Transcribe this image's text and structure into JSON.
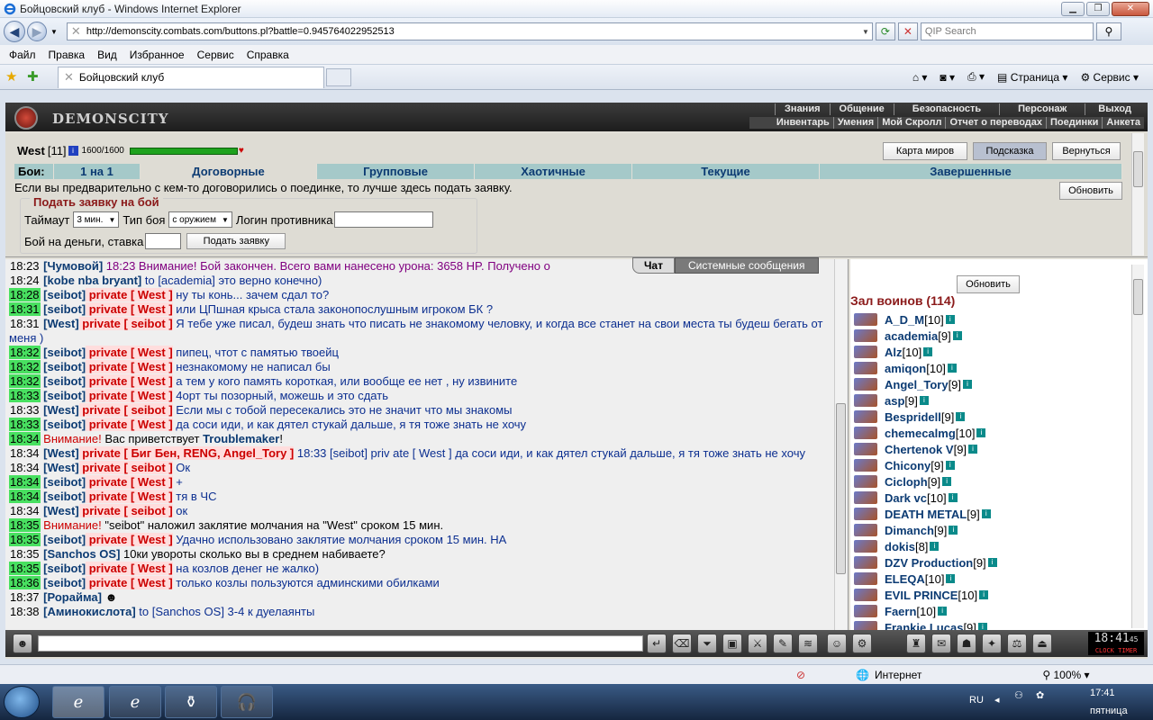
{
  "window": {
    "title": "Бойцовский клуб - Windows Internet Explorer"
  },
  "address": {
    "url": "http://demonscity.combats.com/buttons.pl?battle=0.945764022952513",
    "search_placeholder": "QIP Search"
  },
  "menu": [
    "Файл",
    "Правка",
    "Вид",
    "Избранное",
    "Сервис",
    "Справка"
  ],
  "tab": {
    "title": "Бойцовский клуб",
    "page_label": "Страница",
    "tools_label": "Сервис"
  },
  "site": {
    "logo": "DEMONSCITY",
    "menu_top": [
      "Знания",
      "Общение",
      "Безопасность",
      "Персонаж",
      "Выход"
    ],
    "menu_bottom": [
      "Инвентарь",
      "Умения",
      "Мой Скролл",
      "Отчет о переводах",
      "Поединки",
      "Анкета"
    ]
  },
  "player": {
    "name": "West",
    "level": "[11]",
    "hp": "1600/1600",
    "hp_fraction": 1.0
  },
  "buttons": {
    "map": "Карта миров",
    "hint": "Подсказка",
    "back": "Вернуться",
    "refresh": "Обновить",
    "submit": "Подать заявку",
    "refresh_list": "Обновить"
  },
  "battle_tabs": [
    "Бои:",
    "1 на 1",
    "Договорные",
    "Групповые",
    "Хаотичные",
    "Текущие",
    "Завершенные"
  ],
  "hint_text": "Если вы предварительно с кем-то договорились о поединке, то лучше здесь подать заявку.",
  "form": {
    "legend": "Подать заявку на бой",
    "timeout_label": "Таймаут",
    "timeout_value": "3 мин.",
    "type_label": "Тип боя",
    "type_value": "с оружием",
    "opponent_label": "Логин противника",
    "money_label": "Бой на деньги, ставка"
  },
  "chat_tabs": [
    "Чат",
    "Системные сообщения"
  ],
  "chat": [
    {
      "t": "18:23",
      "hl": false,
      "parts": [
        [
          "nk",
          "[Чумовой] "
        ],
        [
          "sys",
          "18:23 Внимание! Бой закончен. Всего вами нанесено урона: 3658 HP. Получено о"
        ]
      ]
    },
    {
      "t": "18:24",
      "hl": false,
      "parts": [
        [
          "nk",
          "[kobe nba bryant]"
        ],
        [
          "msg",
          " to [academia] это верно конечно)"
        ]
      ]
    },
    {
      "t": "18:28",
      "hl": true,
      "parts": [
        [
          "nk",
          "[seibot]"
        ],
        [
          "pv",
          " private [ West ]"
        ],
        [
          "msg",
          " ну ты конь... зачем сдал то?"
        ]
      ]
    },
    {
      "t": "18:31",
      "hl": true,
      "parts": [
        [
          "nk",
          "[seibot]"
        ],
        [
          "pv",
          " private [ West ]"
        ],
        [
          "msg",
          " или ЦПшная крыса стала законопослушным игроком БК ?"
        ]
      ]
    },
    {
      "t": "18:31",
      "hl": false,
      "parts": [
        [
          "nk",
          "[West]"
        ],
        [
          "pv",
          " private [ seibot ]"
        ],
        [
          "msg",
          " Я тебе уже писал, будеш знать что писать не знакомому человку, и когда все станет на свои места ты будеш бегать от меня )"
        ]
      ]
    },
    {
      "t": "18:32",
      "hl": true,
      "parts": [
        [
          "nk",
          "[seibot]"
        ],
        [
          "pv",
          " private [ West ]"
        ],
        [
          "msg",
          " пипец, чтот с памятью твоейц"
        ]
      ]
    },
    {
      "t": "18:32",
      "hl": true,
      "parts": [
        [
          "nk",
          "[seibot]"
        ],
        [
          "pv",
          " private [ West ]"
        ],
        [
          "msg",
          " незнакомому не написал бы"
        ]
      ]
    },
    {
      "t": "18:32",
      "hl": true,
      "parts": [
        [
          "nk",
          "[seibot]"
        ],
        [
          "pv",
          " private [ West ]"
        ],
        [
          "msg",
          " а тем у кого память короткая, или вообще ее нет , ну извините"
        ]
      ]
    },
    {
      "t": "18:33",
      "hl": true,
      "parts": [
        [
          "nk",
          "[seibot]"
        ],
        [
          "pv",
          " private [ West ]"
        ],
        [
          "msg",
          " 4орт ты позорный, можешь и это сдать"
        ]
      ]
    },
    {
      "t": "18:33",
      "hl": false,
      "parts": [
        [
          "nk",
          "[West]"
        ],
        [
          "pv",
          " private [ seibot ]"
        ],
        [
          "msg",
          " Если мы с тобой пересекались это не значит что мы знакомы"
        ]
      ]
    },
    {
      "t": "18:33",
      "hl": true,
      "parts": [
        [
          "nk",
          "[seibot]"
        ],
        [
          "pv",
          " private [ West ]"
        ],
        [
          "msg",
          " да соси иди, и как дятел стукай дальше, я тя тоже знать не хочу"
        ]
      ]
    },
    {
      "t": "18:34",
      "hl": true,
      "parts": [
        [
          "warn",
          "Внимание!"
        ],
        [
          "",
          "  Вас приветствует "
        ],
        [
          "nk",
          "Troublemaker"
        ],
        [
          "",
          "!"
        ]
      ]
    },
    {
      "t": "18:34",
      "hl": false,
      "parts": [
        [
          "nk",
          "[West]"
        ],
        [
          "pv",
          " private [ Биг Бен, RENG, Angel_Tory ]"
        ],
        [
          "msg",
          " 18:33 [seibot] priv ate [ West ] да соси иди, и как дятел стукай дальше, я тя тоже знать не хочу"
        ]
      ]
    },
    {
      "t": "18:34",
      "hl": false,
      "parts": [
        [
          "nk",
          "[West]"
        ],
        [
          "pv",
          " private [ seibot ]"
        ],
        [
          "msg",
          " Ок"
        ]
      ]
    },
    {
      "t": "18:34",
      "hl": true,
      "parts": [
        [
          "nk",
          "[seibot]"
        ],
        [
          "pv",
          " private [ West ]"
        ],
        [
          "msg",
          " +"
        ]
      ]
    },
    {
      "t": "18:34",
      "hl": true,
      "parts": [
        [
          "nk",
          "[seibot]"
        ],
        [
          "pv",
          " private [ West ]"
        ],
        [
          "msg",
          " тя в ЧС"
        ]
      ]
    },
    {
      "t": "18:34",
      "hl": false,
      "parts": [
        [
          "nk",
          "[West]"
        ],
        [
          "pv",
          " private [ seibot ]"
        ],
        [
          "msg",
          " ок"
        ]
      ]
    },
    {
      "t": "18:35",
      "hl": true,
      "parts": [
        [
          "warn",
          "Внимание!"
        ],
        [
          "",
          "  \"seibot\" наложил заклятие молчания на \"West\" сроком 15 мин."
        ]
      ]
    },
    {
      "t": "18:35",
      "hl": true,
      "parts": [
        [
          "nk",
          "[seibot]"
        ],
        [
          "pv",
          " private [ West ]"
        ],
        [
          "msg",
          " Удачно использовано заклятие молчания сроком 15 мин. НА"
        ]
      ]
    },
    {
      "t": "18:35",
      "hl": false,
      "parts": [
        [
          "nk",
          "[Sanchos OS]"
        ],
        [
          "",
          " 10ки увороты сколько вы в среднем набиваете?"
        ]
      ]
    },
    {
      "t": "18:35",
      "hl": true,
      "parts": [
        [
          "nk",
          "[seibot]"
        ],
        [
          "pv",
          " private [ West ]"
        ],
        [
          "msg",
          " на козлов денег не жалко)"
        ]
      ]
    },
    {
      "t": "18:36",
      "hl": true,
      "parts": [
        [
          "nk",
          "[seibot]"
        ],
        [
          "pv",
          " private [ West ]"
        ],
        [
          "msg",
          " только козлы пользуются админскими обилками"
        ]
      ]
    },
    {
      "t": "18:37",
      "hl": false,
      "parts": [
        [
          "nk",
          "[Рорайма]"
        ],
        [
          "",
          " ☻"
        ]
      ]
    },
    {
      "t": "18:38",
      "hl": false,
      "parts": [
        [
          "nk",
          "[Аминокислота]"
        ],
        [
          "msg",
          " to [Sanchos OS] 3-4 к дуелаянты"
        ]
      ]
    }
  ],
  "hall": {
    "title": "Зал воинов (114)"
  },
  "warriors": [
    {
      "name": "A_D_M",
      "level": "[10]"
    },
    {
      "name": "academia",
      "level": "[9]"
    },
    {
      "name": "Alz",
      "level": "[10]"
    },
    {
      "name": "amiqon",
      "level": "[10]"
    },
    {
      "name": "Angel_Tory",
      "level": "[9]"
    },
    {
      "name": "asp",
      "level": "[9]"
    },
    {
      "name": "Bespridell",
      "level": "[9]"
    },
    {
      "name": "chemecalmg",
      "level": "[10]"
    },
    {
      "name": "Chertenok V",
      "level": "[9]"
    },
    {
      "name": "Chicony",
      "level": "[9]"
    },
    {
      "name": "Cicloph",
      "level": "[9]"
    },
    {
      "name": "Dark vc",
      "level": "[10]"
    },
    {
      "name": "DEATH METAL",
      "level": "[9]"
    },
    {
      "name": "Dimanch",
      "level": "[9]"
    },
    {
      "name": "dokis",
      "level": "[8]"
    },
    {
      "name": "DZV Production",
      "level": "[9]"
    },
    {
      "name": "ELEQA",
      "level": "[10]"
    },
    {
      "name": "EVIL PRINCE",
      "level": "[10]"
    },
    {
      "name": "Faern",
      "level": "[10]"
    },
    {
      "name": "Frankie Lucas",
      "level": "[9]"
    }
  ],
  "clock": {
    "time": "18:41",
    "sec": "45",
    "label1": "CLOCK",
    "label2": "TIMER"
  },
  "status": {
    "zone": "Интернет",
    "zoom": "100%"
  },
  "tray": {
    "lang": "RU",
    "time": "17:41",
    "day": "пятница"
  }
}
